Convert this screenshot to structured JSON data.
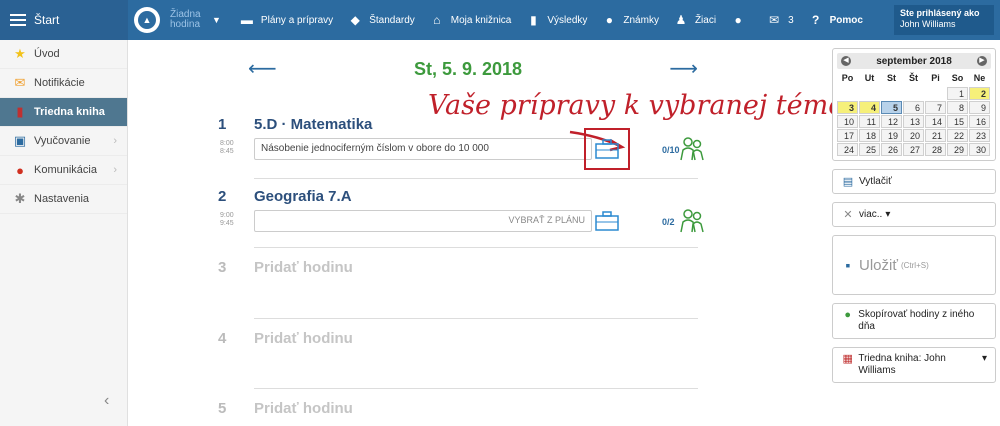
{
  "topbar": {
    "start_label": "Štart",
    "lesson_selector": {
      "line1": "Žiadna",
      "line2": "hodina"
    },
    "nav": [
      {
        "label": "Plány a prípravy",
        "icon": "stack-icon"
      },
      {
        "label": "Štandardy",
        "icon": "shield-icon"
      },
      {
        "label": "Moja knižnica",
        "icon": "library-icon"
      },
      {
        "label": "Výsledky",
        "icon": "bar-chart-icon"
      },
      {
        "label": "Známky",
        "icon": "grade-icon"
      },
      {
        "label": "Žiaci",
        "icon": "students-icon"
      }
    ],
    "chat_icon": "chat-icon",
    "mail_count": "3",
    "help_label": "Pomoc",
    "user": {
      "caption": "Ste prihlásený ako",
      "name": "John Williams"
    }
  },
  "sidebar": {
    "items": [
      {
        "label": "Úvod",
        "icon": "star-icon",
        "active": false,
        "arrow": false
      },
      {
        "label": "Notifikácie",
        "icon": "envelope-icon",
        "active": false,
        "arrow": false
      },
      {
        "label": "Triedna kniha",
        "icon": "book-icon",
        "active": true,
        "arrow": false
      },
      {
        "label": "Vyučovanie",
        "icon": "briefcase-icon",
        "active": false,
        "arrow": true
      },
      {
        "label": "Komunikácia",
        "icon": "chat-icon",
        "active": false,
        "arrow": true
      },
      {
        "label": "Nastavenia",
        "icon": "gear-icon",
        "active": false,
        "arrow": false
      }
    ]
  },
  "main": {
    "date": "St, 5. 9. 2018",
    "annotation": "Vaše prípravy k vybranej téme",
    "lessons": [
      {
        "num": "1",
        "title": "5.D · Matematika",
        "time_start": "8:00",
        "time_end": "8:45",
        "topic": "Násobenie jednociferným číslom v obore do 10 000",
        "count": "0/10"
      },
      {
        "num": "2",
        "title": "Geografia 7.A",
        "time_start": "9:00",
        "time_end": "9:45",
        "topic": "VYBRAŤ Z PLÁNU",
        "count": "0/2"
      }
    ],
    "empty_slots": [
      {
        "num": "3",
        "label": "Pridať hodinu"
      },
      {
        "num": "4",
        "label": "Pridať hodinu"
      },
      {
        "num": "5",
        "label": "Pridať hodinu"
      }
    ]
  },
  "calendar": {
    "month_label": "september 2018",
    "weekdays": [
      "Po",
      "Ut",
      "St",
      "Št",
      "Pi",
      "So",
      "Ne"
    ],
    "days": [
      "",
      "",
      "",
      "",
      "",
      "1",
      "2",
      "3",
      "4",
      "5",
      "6",
      "7",
      "8",
      "9",
      "10",
      "11",
      "12",
      "13",
      "14",
      "15",
      "16",
      "17",
      "18",
      "19",
      "20",
      "21",
      "22",
      "23",
      "24",
      "25",
      "26",
      "27",
      "28",
      "29",
      "30"
    ],
    "highlight_yellow": [
      "2",
      "3",
      "4"
    ],
    "selected": "5"
  },
  "actions": {
    "print_label": "Vytlačiť",
    "more_label": "viac..",
    "save_label": "Uložiť",
    "save_shortcut": "(Ctrl+S)",
    "copy_label": "Skopírovať hodiny z iného dňa",
    "classbook_label": "Triedna kniha: John Williams"
  },
  "colors": {
    "topbar": "#2c6ba0",
    "accent_green": "#3d9a3d",
    "annotation_red": "#c0202a",
    "sidebar_active": "#4f7790"
  }
}
